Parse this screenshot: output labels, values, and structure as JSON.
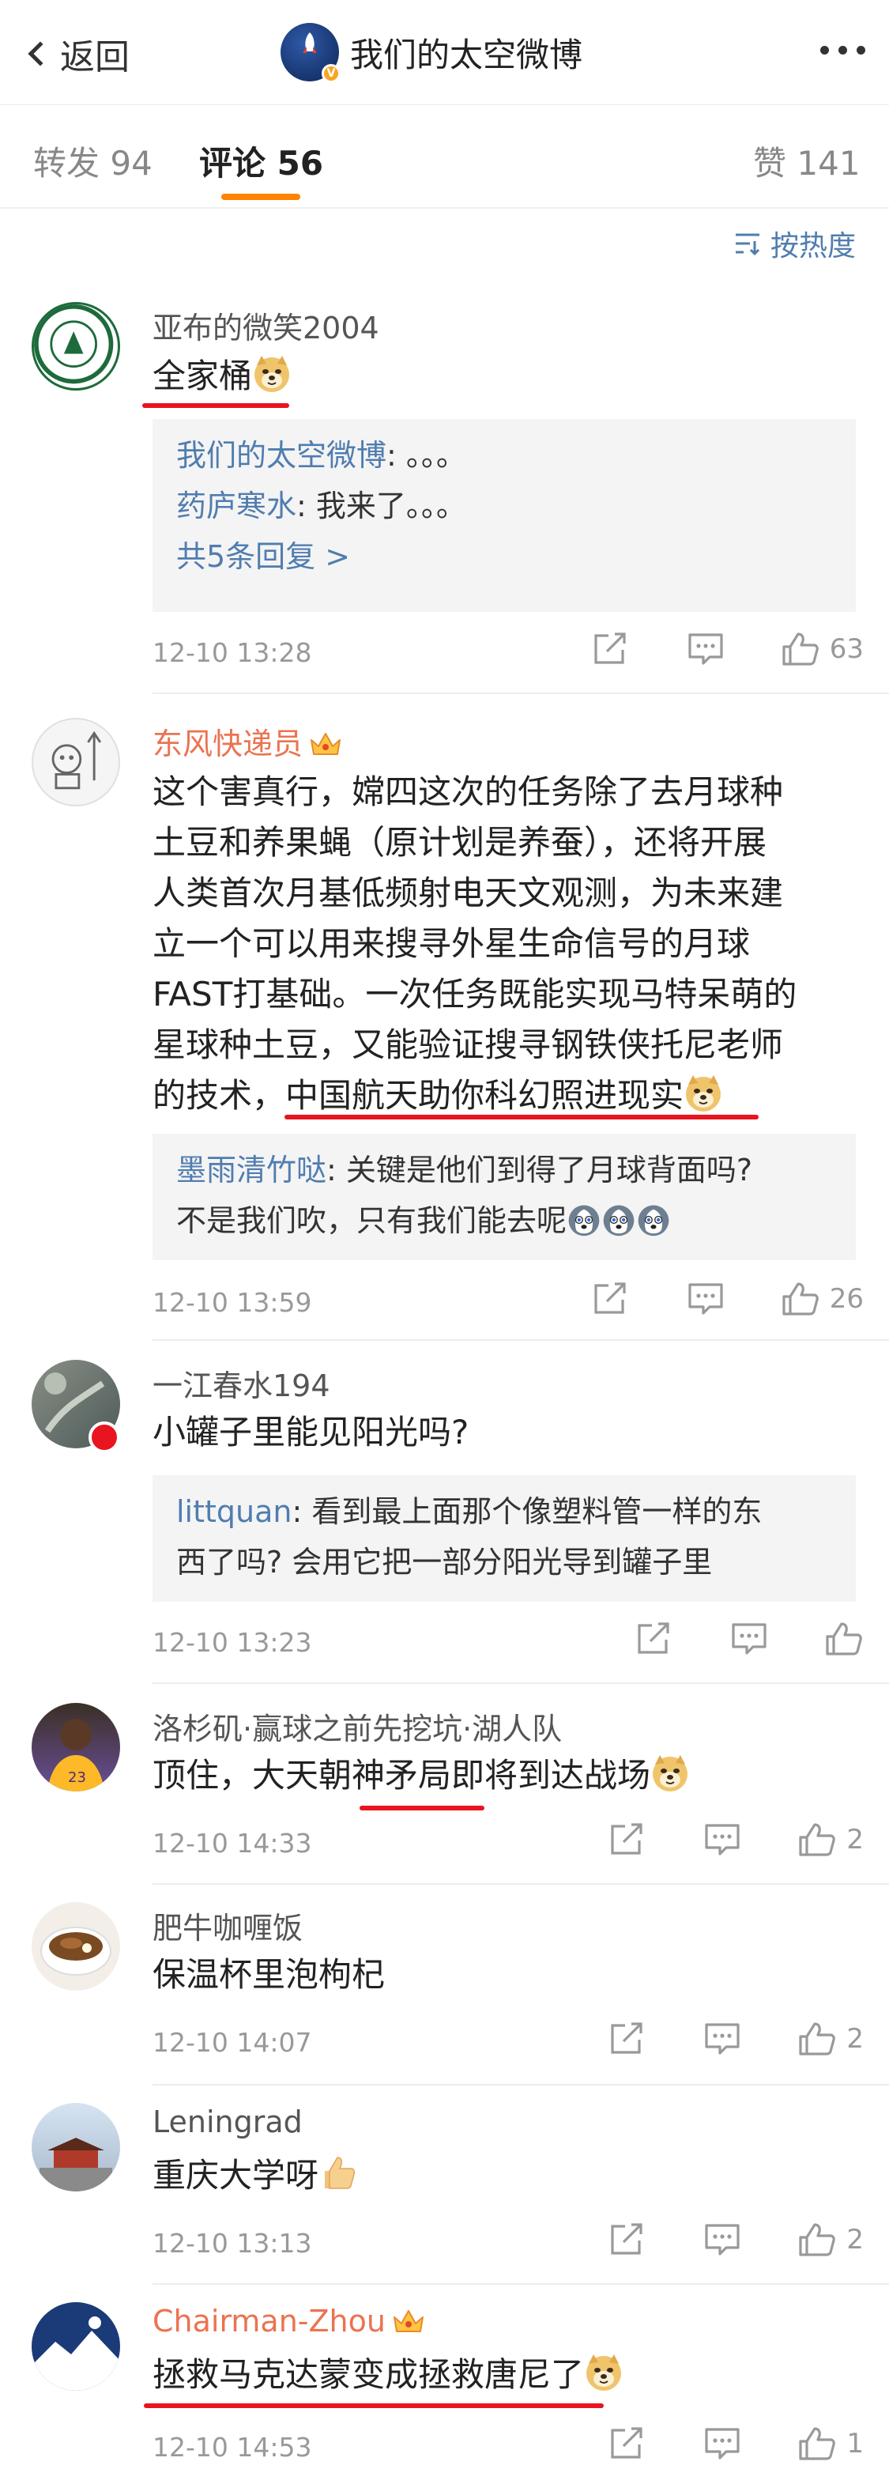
{
  "nav": {
    "back_label": "返回",
    "title": "我们的太空微博",
    "avatar_text": "我们的太空"
  },
  "tabs": [
    {
      "label": "转发",
      "count": "94"
    },
    {
      "label": "评论",
      "count": "56",
      "active": true
    },
    {
      "label": "赞",
      "count": "141"
    }
  ],
  "sort_label": "按热度",
  "colors": {
    "accent": "#ff8200",
    "link": "#507daf",
    "vip_name": "#eb7350",
    "highlight_underline": "#e8141f"
  },
  "comments": [
    {
      "user": "亚布的微笑2004",
      "text": "全家桶",
      "emoji": "doge-emoji",
      "replies": [
        {
          "user": "我们的太空微博",
          "text": ": 。。。"
        },
        {
          "user": "药庐寒水",
          "text": ": 我来了。。。"
        }
      ],
      "more_replies": "共5条回复 >",
      "time": "12-10 13:28",
      "likes": "63"
    },
    {
      "user": "东风快递员",
      "vip": true,
      "text_lines": [
        "这个害真行，嫦四这次的任务除了去月球种",
        "土豆和养果蝇（原计划是养蚕），还将开展",
        "人类首次月基低频射电天文观测，为未来建",
        "立一个可以用来搜寻外星生命信号的月球",
        "FAST打基础。一次任务既能实现马特呆萌的",
        "星球种土豆，又能验证搜寻钢铁侠托尼老师"
      ],
      "text_last_prefix": "的技术，",
      "text_last_highlight": "中国航天助你科幻照进现实",
      "replies": [
        {
          "user": "墨雨清竹哒",
          "text": ": 关键是他们到得了月球背面吗?",
          "text2": "不是我们吹，只有我们能去呢"
        }
      ],
      "time": "12-10 13:59",
      "likes": "26"
    },
    {
      "user": "一江春水194",
      "text": "小罐子里能见阳光吗?",
      "replies": [
        {
          "user": "littquan",
          "text": ": 看到最上面那个像塑料管一样的东",
          "text2": "西了吗? 会用它把一部分阳光导到罐子里"
        }
      ],
      "time": "12-10 13:23",
      "likes": ""
    },
    {
      "user": "洛杉矶·赢球之前先挖坑·湖人队",
      "text": "顶住，大天朝神矛局即将到达战场",
      "time": "12-10 14:33",
      "likes": "2"
    },
    {
      "user": "肥牛咖喱饭",
      "text": "保温杯里泡枸杞",
      "time": "12-10 14:07",
      "likes": "2"
    },
    {
      "user": "Leningrad",
      "text": "重庆大学呀",
      "time": "12-10 13:13",
      "likes": "2"
    },
    {
      "user": "Chairman-Zhou",
      "vip": true,
      "text": "拯救马克达蒙变成拯救唐尼了",
      "time": "12-10 14:53",
      "likes": "1"
    }
  ]
}
